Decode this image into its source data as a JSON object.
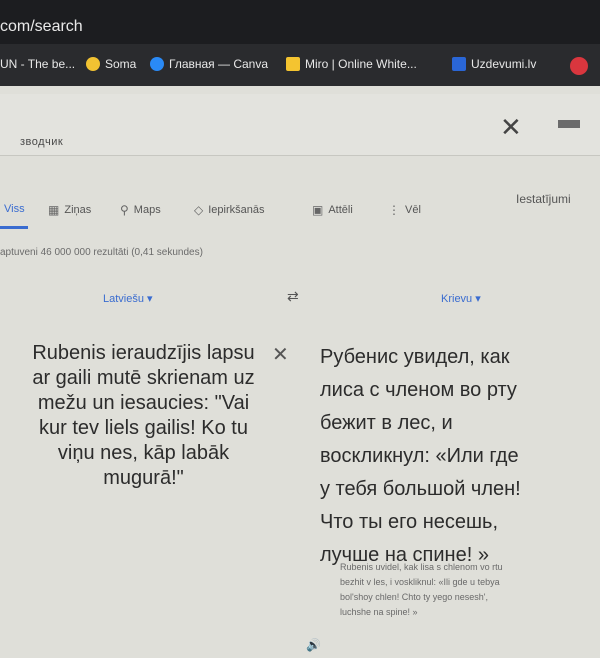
{
  "browser": {
    "url": "com/search",
    "bookmarks": [
      {
        "label": "UN - The be...",
        "icon": "bookmark-icon",
        "color": "#e8e8e8"
      },
      {
        "label": "Soma",
        "icon": "soma-icon",
        "color": "#f1c232"
      },
      {
        "label": "Главная — Canva",
        "icon": "canva-icon",
        "color": "#2a8af6"
      },
      {
        "label": "Miro | Online White...",
        "icon": "miro-icon",
        "color": "#f4c430"
      },
      {
        "label": "Uzdevumi.lv",
        "icon": "uzdevumi-icon",
        "color": "#2a66d6"
      },
      {
        "label": "",
        "icon": "pinterest-icon",
        "color": "#d9363e"
      }
    ]
  },
  "search": {
    "query": "зводчик"
  },
  "tabs": [
    {
      "label": "Viss",
      "icon": "",
      "active": true
    },
    {
      "label": "Ziņas",
      "icon": "news-icon",
      "active": false
    },
    {
      "label": "Maps",
      "icon": "map-pin-icon",
      "active": false
    },
    {
      "label": "Iepirkšanās",
      "icon": "shopping-tag-icon",
      "active": false
    },
    {
      "label": "Attēli",
      "icon": "image-icon",
      "active": false
    },
    {
      "label": "Vēl",
      "icon": "more-vert-icon",
      "active": false
    }
  ],
  "settings_label": "Iestatījumi",
  "results_stats": "aptuveni 46 000 000 rezultāti (0,41 sekundes)",
  "translator": {
    "source_lang": "Latviešu ▾",
    "target_lang": "Krievu ▾",
    "source_text": "Rubenis ieraudzījis lapsu ar gaili mutē skrienam uz mežu un iesaucies: \"Vai kur tev liels gailis! Ko tu viņu nes, kāp labāk mugurā!\"",
    "target_text": "Рубенис увидел, как\nлиса с членом во рту\nбежит в лес, и\nвоскликнул: «Или где\nу тебя большой член!\nЧто ты его несешь,\nлучше на спине! »",
    "transliteration": "Rubenis uvidel, kak lisa s chlenom vo rtu\nbezhit v les, i voskliknul: «Ili gde u tebya\nbol'shoy chlen! Chto ty yego nesesh',\nluchshe na spine! »"
  },
  "colors": {
    "accent": "#3a6cd0",
    "browser_bar": "#1c1d20",
    "page_bg": "#dfdfd9"
  }
}
